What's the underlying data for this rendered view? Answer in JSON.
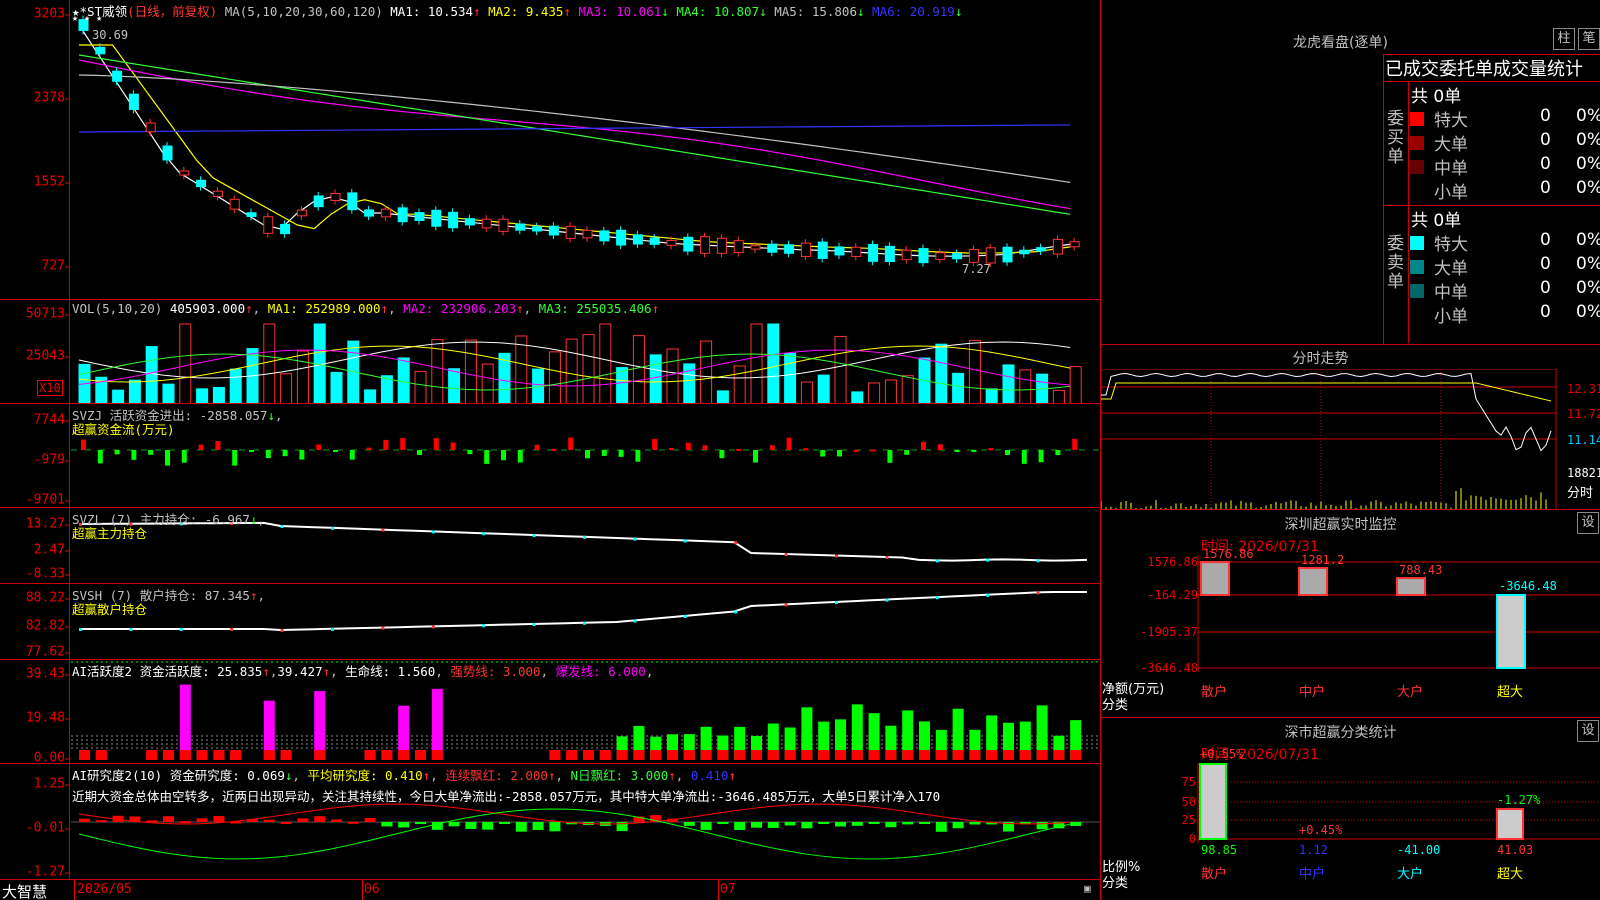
{
  "header": {
    "stock_name": "★*ST威领",
    "period": "(日线，前复权)",
    "ma_label": "MA(5,10,20,30,60,120)",
    "ma1": "MA1: 10.534",
    "ma1_arrow": "↑",
    "ma2": "MA2: 9.435",
    "ma2_arrow": "↑",
    "ma3": "MA3: 10.061",
    "ma3_arrow": "↓",
    "ma4": "MA4: 10.807",
    "ma4_arrow": "↓",
    "ma5": "MA5: 15.806",
    "ma5_arrow": "↓",
    "ma6": "MA6: 20.919",
    "ma6_arrow": "↓",
    "high_mark": "30.69",
    "low_mark": "7.27",
    "yticks": [
      "3203",
      "2378",
      "1552",
      "727"
    ],
    "marks": "★  ★  ★"
  },
  "vol": {
    "label": "VOL(5,10,20)",
    "value": "405903.000",
    "ma1": "MA1: 252989.000",
    "ma2": "MA2: 232906.203",
    "ma3": "MA3: 255035.406",
    "yticks": [
      "50713",
      "25043"
    ],
    "unit": "X10"
  },
  "svzj": {
    "label": "SVZJ  活跃资金进出: -2858.057",
    "sub": "超赢资金流(万元)",
    "yticks": [
      "7744",
      "-979",
      "-9701"
    ]
  },
  "svzl": {
    "label": "SVZL (7) 主力持仓: -6.967",
    "sub": "超赢主力持仓",
    "yticks": [
      "13.27",
      "2.47",
      "-8.33"
    ]
  },
  "svsh": {
    "label": "SVSH (7) 散户持仓: 87.345",
    "sub": "超赢散户持仓",
    "yticks": [
      "88.22",
      "82.82",
      "77.62"
    ]
  },
  "ai2": {
    "label": "AI活跃度2 资金活跃度: 25.835",
    "v2": "39.427",
    "life": "生命线: 1.560",
    "strong": "强势线: 3.000",
    "burst": "爆发线: 6.000",
    "yticks": [
      "39.43",
      "19.48",
      "0.00"
    ]
  },
  "ai_research": {
    "label": "AI研究度2(10) 资金研究度: 0.069",
    "avg": "平均研究度: 0.410",
    "red": "连续飘红: 2.000",
    "nred": "N日飘红: 3.000",
    "last": "0.410",
    "comment": "近期大资金总体由空转多，近两日出现异动，关注其持续性，今日大单净流出:-2858.057万元，其中特大单净流出:-3646.485万元，大单5日累计净入170",
    "yticks": [
      "1.25",
      "-0.01",
      "-1.27"
    ]
  },
  "xaxis": {
    "brand": "大智慧",
    "labels": [
      "2026/05",
      "06",
      "07"
    ]
  },
  "right": {
    "dragon_title": "龙虎看盘(逐单)",
    "btn1": "柱",
    "btn2": "笔",
    "stats_title": "已成交委托单成交量统计",
    "buy_label": "委买单",
    "sell_label": "委卖单",
    "buy_total": "共 0单",
    "sell_total": "共 0单",
    "buy_rows": [
      {
        "name": "特大",
        "v": "0",
        "p": "0%",
        "color": "#ff0000"
      },
      {
        "name": "大单",
        "v": "0",
        "p": "0%",
        "color": "#990000"
      },
      {
        "name": "中单",
        "v": "0",
        "p": "0%",
        "color": "#660000"
      },
      {
        "name": "小单",
        "v": "0",
        "p": "0%",
        "color": "#000000"
      }
    ],
    "sell_rows": [
      {
        "name": "特大",
        "v": "0",
        "p": "0%",
        "color": "#00ffff"
      },
      {
        "name": "大单",
        "v": "0",
        "p": "0%",
        "color": "#008888"
      },
      {
        "name": "中单",
        "v": "0",
        "p": "0%",
        "color": "#006666"
      },
      {
        "name": "小单",
        "v": "0",
        "p": "0%",
        "color": "#000000"
      }
    ],
    "intraday_title": "分时走势",
    "intraday_ticks": [
      "12.31",
      "11.72",
      "11.14"
    ],
    "intraday_vol": "18821",
    "intraday_unit": "分时",
    "sz_title": "深圳超赢实时监控",
    "sz_set": "设",
    "sz_time": "时间: 2026/07/31",
    "sz_yticks": [
      "1576.86",
      "-164.29",
      "-1905.37",
      "-3646.48"
    ],
    "sz_ylabel": "净额(万元)",
    "sz_xlabel": "分类",
    "sz_cats": [
      "散户",
      "中户",
      "大户",
      "超大"
    ],
    "sz_vals": [
      "1576.86",
      "1281.2",
      "788.43",
      "-3646.48"
    ],
    "cls_title": "深市超赢分类统计",
    "cls_set": "设",
    "cls_time": "时间: 2026/07/31",
    "cls_yticks": [
      "75",
      "50",
      "25",
      "0"
    ],
    "cls_ylabel": "比例%",
    "cls_xlabel": "分类",
    "cls_pcts": [
      "+0.55%",
      "+0.45%",
      "-1.27%"
    ],
    "cls_cats": [
      "散户",
      "中户",
      "大户",
      "超大"
    ],
    "cls_vals": [
      "98.85",
      "1.12",
      "-41.00",
      "41.03"
    ]
  },
  "chart_data": [
    {
      "type": "candlestick",
      "title": "★*ST威领(日线，前复权)",
      "x": [
        "2026/05",
        "06",
        "07"
      ],
      "ylim": [
        727,
        3203
      ],
      "note_high": "30.69",
      "note_low": "7.27"
    },
    {
      "type": "bar",
      "title": "VOL(5,10,20)",
      "ylim": [
        0,
        50713
      ]
    },
    {
      "type": "bar",
      "title": "超赢资金流(万元)",
      "ylim": [
        -9701,
        7744
      ]
    },
    {
      "type": "line",
      "title": "超赢主力持仓",
      "ylim": [
        -8.33,
        13.27
      ]
    },
    {
      "type": "line",
      "title": "超赢散户持仓",
      "ylim": [
        77.62,
        88.22
      ]
    },
    {
      "type": "bar",
      "title": "深圳超赢实时监控",
      "categories": [
        "散户",
        "中户",
        "大户",
        "超大"
      ],
      "values": [
        1576.86,
        1281.2,
        788.43,
        -3646.48
      ],
      "ylabel": "净额(万元)",
      "xlabel": "分类"
    },
    {
      "type": "bar",
      "title": "深市超赢分类统计",
      "categories": [
        "散户",
        "中户",
        "大户",
        "超大"
      ],
      "values": [
        98.85,
        1.12,
        -41.0,
        41.03
      ],
      "ylabel": "比例%",
      "xlabel": "分类"
    }
  ]
}
